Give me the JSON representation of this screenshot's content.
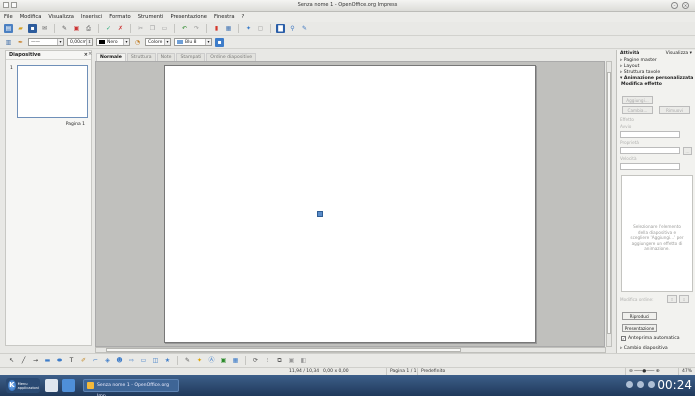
{
  "window": {
    "title": "Senza nome 1 - OpenOffice.org Impress"
  },
  "menu": [
    "File",
    "Modifica",
    "Visualizza",
    "Inserisci",
    "Formato",
    "Strumenti",
    "Presentazione",
    "Finestra",
    "?"
  ],
  "toolbar2": {
    "line_color_label": "Nero",
    "area_style_label": "Colore",
    "area_color_label": "Blu 8",
    "line_width_value": "0,00cm"
  },
  "slides_pane": {
    "title": "Diapositive",
    "close_glyph": "×",
    "slide_number": "1",
    "slide_name": "Pagina 1"
  },
  "view_tabs": [
    {
      "label": "Normale",
      "active": true
    },
    {
      "label": "Struttura",
      "active": false
    },
    {
      "label": "Note",
      "active": false
    },
    {
      "label": "Stampati",
      "active": false
    },
    {
      "label": "Ordine diapositive",
      "active": false
    }
  ],
  "task_pane": {
    "title": "Attività",
    "view_label": "Visualizza ▾",
    "sections": [
      {
        "label": "▹ Pagine master",
        "bold": false
      },
      {
        "label": "▹ Layout",
        "bold": false
      },
      {
        "label": "▹ Struttura tavole",
        "bold": false
      },
      {
        "label": "▾ Animazione personalizzata",
        "bold": true
      }
    ],
    "modify_effect": "Modifica effetto",
    "add_button": "Aggiungi...",
    "change_button": "Cambia...",
    "remove_button": "Rimuovi",
    "effect_label": "Effetto",
    "start_label": "Avvio",
    "property_label": "Proprietà",
    "speed_label": "Velocità",
    "empty_message": "Selezionare l'elemento della diapositiva e scegliere 'Aggiungi...' per aggiungere un effetto di animazione.",
    "change_order_label": "Modifica ordine:",
    "play_button": "Riproduci",
    "presentation_button": "Presentazione",
    "auto_preview_label": "Anteprima automatica",
    "slide_transition": "▹ Cambio diapositiva"
  },
  "status_bar": {
    "position": "11,94 / 10,34",
    "size": "0,00 x 0,00",
    "page": "Pagina 1 / 1",
    "layout": "Predefinito",
    "zoom": "47%"
  },
  "taskbar": {
    "start_label": "Menu applicazioni",
    "task_item": "Senza nome 1 - OpenOffice.org Imp",
    "clock": "00:24"
  },
  "colors": {
    "taskbar": "#2a4a73",
    "accent": "#6f8fb8",
    "placeholder": "#5a8cc9"
  },
  "icons": [
    "new-icon",
    "open-icon",
    "save-icon",
    "email-icon",
    "edit-icon",
    "pdf-icon",
    "print-icon",
    "spellcheck-icon",
    "autospell-icon",
    "cut-icon",
    "copy-icon",
    "paste-icon",
    "undo-icon",
    "redo-icon",
    "chart-icon",
    "table-icon",
    "navigator-icon",
    "gallery-icon",
    "help-icon"
  ]
}
